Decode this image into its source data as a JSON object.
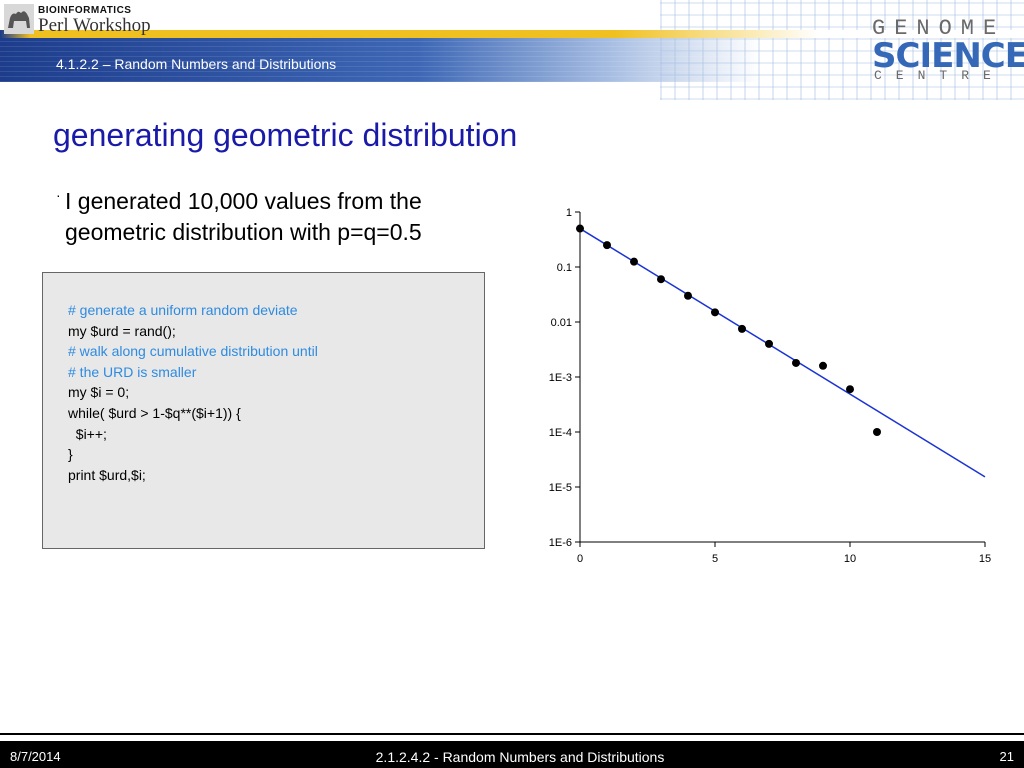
{
  "header": {
    "logo_line1": "BIOINFORMATICS",
    "logo_line2": "Perl Workshop",
    "subtitle": "4.1.2.2 – Random Numbers and Distributions",
    "gsc_genome": "GENOME",
    "gsc_sciences": "SCIENCES",
    "gsc_centre": "CENTRE"
  },
  "slide": {
    "title": "generating geometric distribution",
    "bullet_mark": "·",
    "bullet_text": "I generated 10,000 values from the geometric distribution with p=q=0.5"
  },
  "code": {
    "lines": [
      {
        "text": "# generate a uniform random deviate",
        "type": "comment"
      },
      {
        "text": "my $urd = rand();",
        "type": "code"
      },
      {
        "text": "# walk along cumulative distribution until",
        "type": "comment"
      },
      {
        "text": "# the URD is smaller",
        "type": "comment"
      },
      {
        "text": "my $i = 0;",
        "type": "code"
      },
      {
        "text": "while( $urd > 1-$q**($i+1)) {",
        "type": "code"
      },
      {
        "text": "  $i++;",
        "type": "code"
      },
      {
        "text": "}",
        "type": "code"
      },
      {
        "text": "print $urd,$i;",
        "type": "code"
      }
    ]
  },
  "chart_data": {
    "type": "scatter",
    "xlim": [
      0,
      15
    ],
    "ylim": [
      1e-06,
      1
    ],
    "yscale": "log",
    "x_ticks": [
      0,
      5,
      10,
      15
    ],
    "x_tick_labels": [
      "0",
      "5",
      "10",
      "15"
    ],
    "y_ticks": [
      1,
      0.1,
      0.01,
      0.001,
      0.0001,
      1e-05,
      1e-06
    ],
    "y_tick_labels": [
      "1",
      "0.1",
      "0.01",
      "1E-3",
      "1E-4",
      "1E-5",
      "1E-6"
    ],
    "grid": false,
    "series": [
      {
        "kind": "points",
        "x": [
          0,
          1,
          2,
          3,
          4,
          5,
          6,
          7,
          8,
          9,
          10,
          11
        ],
        "y": [
          0.5,
          0.25,
          0.125,
          0.06,
          0.03,
          0.015,
          0.0075,
          0.004,
          0.0018,
          0.0016,
          0.0006,
          0.0001
        ]
      },
      {
        "kind": "line",
        "x": [
          0,
          15
        ],
        "y": [
          0.5,
          1.53e-05
        ]
      }
    ],
    "point_color": "#000000",
    "line_color": "#1a33d6"
  },
  "footer": {
    "date": "8/7/2014",
    "title": "2.1.2.4.2 - Random Numbers and Distributions",
    "page": "21"
  }
}
